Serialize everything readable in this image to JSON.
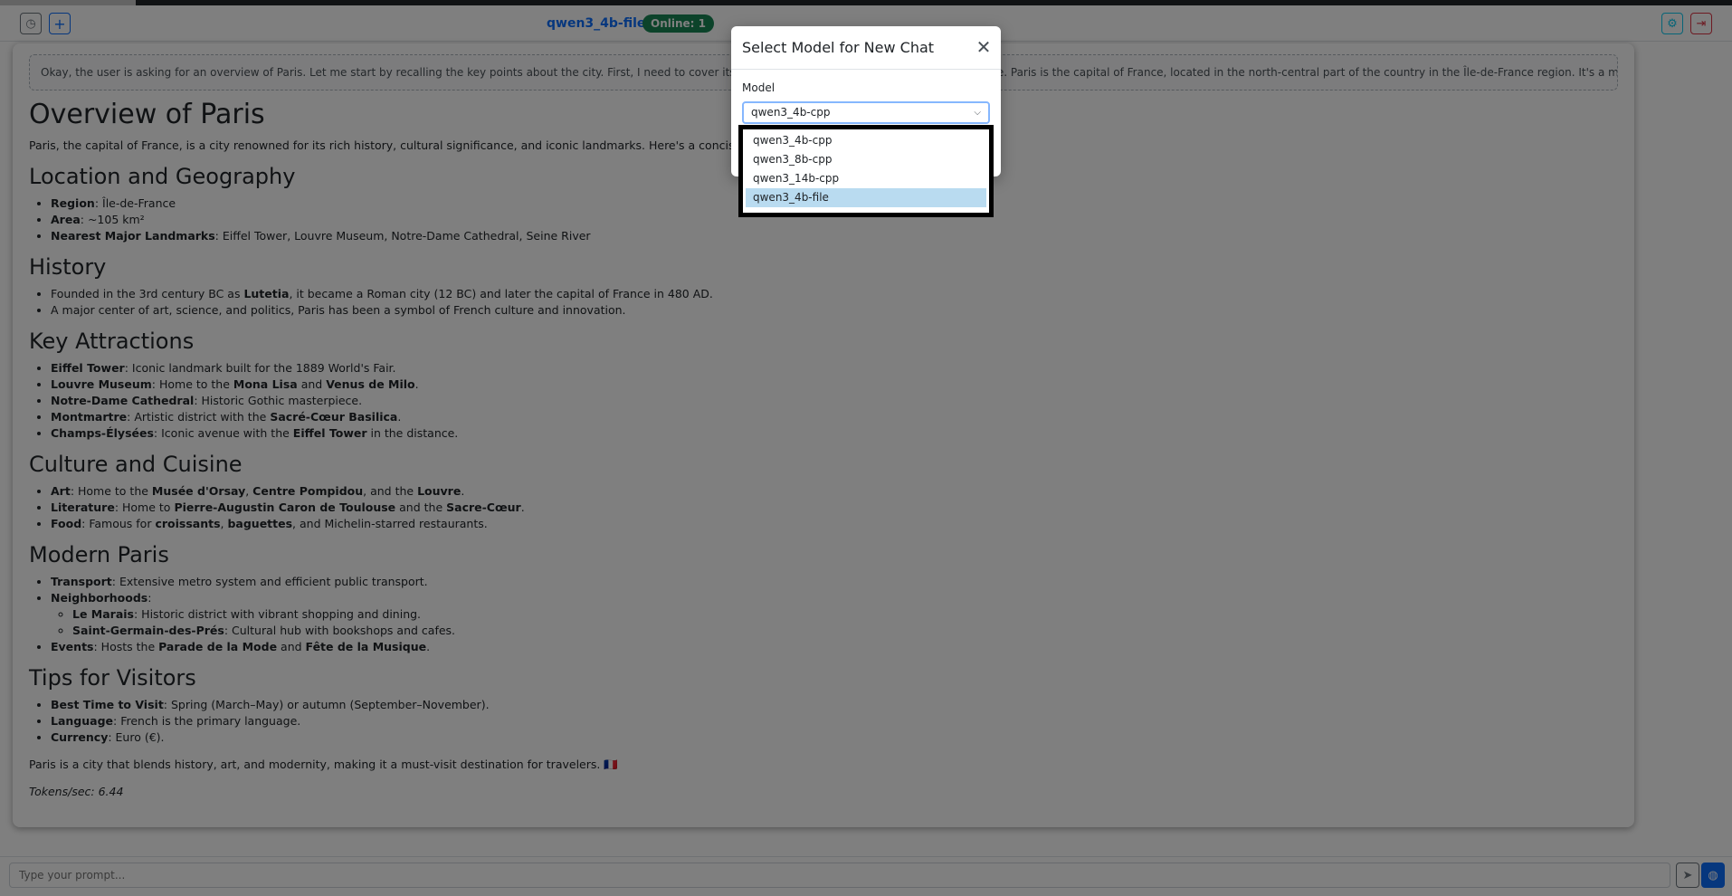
{
  "header": {
    "model_name": "qwen3_4b-file",
    "online_badge": "Online: 1"
  },
  "thinking": "Okay, the user is asking for an overview of Paris. Let me start by recalling the key points about the city. First, I need to cover its location, history, landmarks, culture, and cuisine. Paris is the capital of France, located in the north-central part of the country in the Île-de-France region. It's a major cultural and historical center.",
  "content": {
    "h1": "Overview of Paris",
    "intro": "Paris, the capital of France, is a city renowned for its rich history, cultural significance, and iconic landmarks. Here's a concise overview:",
    "sec_location": {
      "title": "Location and Geography",
      "region_label": "Region",
      "region_value": ": Île-de-France",
      "area_label": "Area",
      "area_value": ": ~105 km²",
      "landmarks_label": "Nearest Major Landmarks",
      "landmarks_value": ": Eiffel Tower, Louvre Museum, Notre-Dame Cathedral, Seine River"
    },
    "sec_history": {
      "title": "History",
      "i1_a": "Founded in the 3rd century BC as ",
      "i1_b": "Lutetia",
      "i1_c": ", it became a Roman city (12 BC) and later the capital of France in 480 AD.",
      "i2": "A major center of art, science, and politics, Paris has been a symbol of French culture and innovation."
    },
    "sec_attractions": {
      "title": "Key Attractions",
      "eiffel_label": "Eiffel Tower",
      "eiffel_value": ": Iconic landmark built for the 1889 World's Fair.",
      "louvre_label": "Louvre Museum",
      "louvre_a": ": Home to the ",
      "louvre_b": "Mona Lisa",
      "louvre_c": " and ",
      "louvre_d": "Venus de Milo",
      "louvre_e": ".",
      "notre_label": "Notre-Dame Cathedral",
      "notre_value": ": Historic Gothic masterpiece.",
      "mont_label": "Montmartre",
      "mont_a": ": Artistic district with the ",
      "mont_b": "Sacré-Cœur Basilica",
      "mont_c": ".",
      "champs_label": "Champs-Élysées",
      "champs_a": ": Iconic avenue with the ",
      "champs_b": "Eiffel Tower",
      "champs_c": " in the distance."
    },
    "sec_culture": {
      "title": "Culture and Cuisine",
      "art_label": "Art",
      "art_a": ": Home to the ",
      "art_b": "Musée d'Orsay",
      "art_c": ", ",
      "art_d": "Centre Pompidou",
      "art_e": ", and the ",
      "art_f": "Louvre",
      "art_g": ".",
      "lit_label": "Literature",
      "lit_a": ": Home to ",
      "lit_b": "Pierre-Augustin Caron de Toulouse",
      "lit_c": " and the ",
      "lit_d": "Sacre-Cœur",
      "lit_e": ".",
      "food_label": "Food",
      "food_a": ": Famous for ",
      "food_b": "croissants",
      "food_c": ", ",
      "food_d": "baguettes",
      "food_e": ", and Michelin-starred restaurants."
    },
    "sec_modern": {
      "title": "Modern Paris",
      "transport_label": "Transport",
      "transport_value": ": Extensive metro system and efficient public transport.",
      "neigh_label": "Neighborhoods",
      "neigh_value": ":",
      "marais_label": "Le Marais",
      "marais_value": ": Historic district with vibrant shopping and dining.",
      "sg_label": "Saint-Germain-des-Prés",
      "sg_value": ": Cultural hub with bookshops and cafes.",
      "events_label": "Events",
      "events_a": ": Hosts the ",
      "events_b": "Parade de la Mode",
      "events_c": " and ",
      "events_d": "Fête de la Musique",
      "events_e": "."
    },
    "sec_tips": {
      "title": "Tips for Visitors",
      "time_label": "Best Time to Visit",
      "time_value": ": Spring (March–May) or autumn (September–November).",
      "lang_label": "Language",
      "lang_value": ": French is the primary language.",
      "cur_label": "Currency",
      "cur_value": ": Euro (€)."
    },
    "closing": "Paris is a city that blends history, art, and modernity, making it a must-visit destination for travelers. 🇫🇷",
    "tokens": "Tokens/sec: 6.44"
  },
  "prompt": {
    "placeholder": "Type your prompt..."
  },
  "modal": {
    "title": "Select Model for New Chat",
    "model_label": "Model",
    "selected": "qwen3_4b-cpp",
    "options": [
      "qwen3_4b-cpp",
      "qwen3_8b-cpp",
      "qwen3_14b-cpp",
      "qwen3_4b-file"
    ],
    "highlighted_option": "qwen3_4b-file"
  },
  "colors": {
    "primary": "#0d6efd",
    "success": "#198754",
    "danger": "#dc3545",
    "info": "#0dcaf0",
    "highlight": "#b9dbf0"
  },
  "icons": {
    "history": "history-icon",
    "new_chat": "plus-icon",
    "settings": "gear-icon",
    "logout": "logout-icon",
    "send": "send-icon",
    "web": "globe-icon",
    "close": "close-icon",
    "dropdown": "chevron-down-icon"
  }
}
